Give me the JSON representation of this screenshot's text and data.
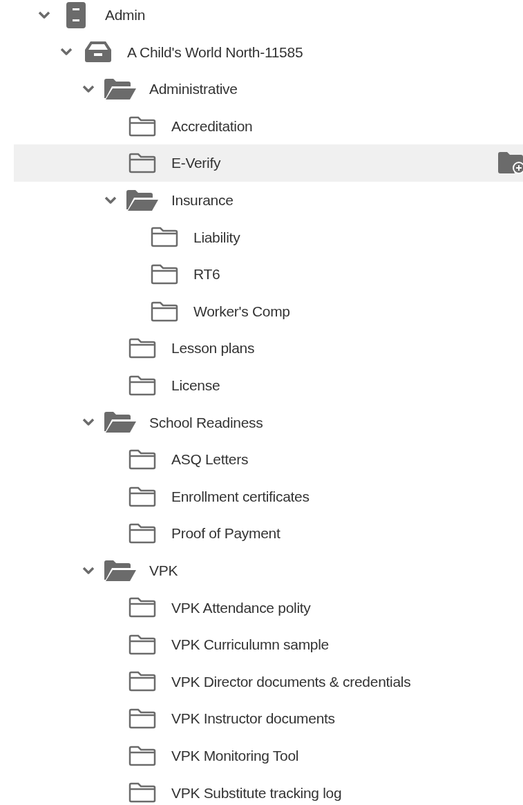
{
  "tree": [
    {
      "label": "Admin",
      "kind": "cabinet",
      "expanded": true,
      "selected": false,
      "children": [
        {
          "label": "A Child's World North-11585",
          "kind": "drawer",
          "expanded": true,
          "selected": false,
          "children": [
            {
              "label": "Administrative",
              "kind": "folder",
              "expanded": true,
              "selected": false,
              "children": [
                {
                  "label": "Accreditation",
                  "kind": "folder",
                  "selected": false
                },
                {
                  "label": "E-Verify",
                  "kind": "folder",
                  "selected": true
                },
                {
                  "label": "Insurance",
                  "kind": "folder",
                  "expanded": true,
                  "selected": false,
                  "children": [
                    {
                      "label": "Liability",
                      "kind": "folder",
                      "selected": false
                    },
                    {
                      "label": "RT6",
                      "kind": "folder",
                      "selected": false
                    },
                    {
                      "label": "Worker's Comp",
                      "kind": "folder",
                      "selected": false
                    }
                  ]
                },
                {
                  "label": "Lesson plans",
                  "kind": "folder",
                  "selected": false
                },
                {
                  "label": "License",
                  "kind": "folder",
                  "selected": false
                }
              ]
            },
            {
              "label": "School Readiness",
              "kind": "folder",
              "expanded": true,
              "selected": false,
              "children": [
                {
                  "label": "ASQ Letters",
                  "kind": "folder",
                  "selected": false
                },
                {
                  "label": "Enrollment certificates",
                  "kind": "folder",
                  "selected": false
                },
                {
                  "label": "Proof of Payment",
                  "kind": "folder",
                  "selected": false
                }
              ]
            },
            {
              "label": "VPK",
              "kind": "folder",
              "expanded": true,
              "selected": false,
              "children": [
                {
                  "label": "VPK Attendance polity",
                  "kind": "folder",
                  "selected": false
                },
                {
                  "label": "VPK Curriculumn sample",
                  "kind": "folder",
                  "selected": false
                },
                {
                  "label": "VPK Director documents & credentials",
                  "kind": "folder",
                  "selected": false
                },
                {
                  "label": "VPK Instructor documents",
                  "kind": "folder",
                  "selected": false
                },
                {
                  "label": "VPK Monitoring Tool",
                  "kind": "folder",
                  "selected": false
                },
                {
                  "label": "VPK Substitute tracking log",
                  "kind": "folder",
                  "selected": false
                }
              ]
            }
          ]
        }
      ]
    }
  ]
}
